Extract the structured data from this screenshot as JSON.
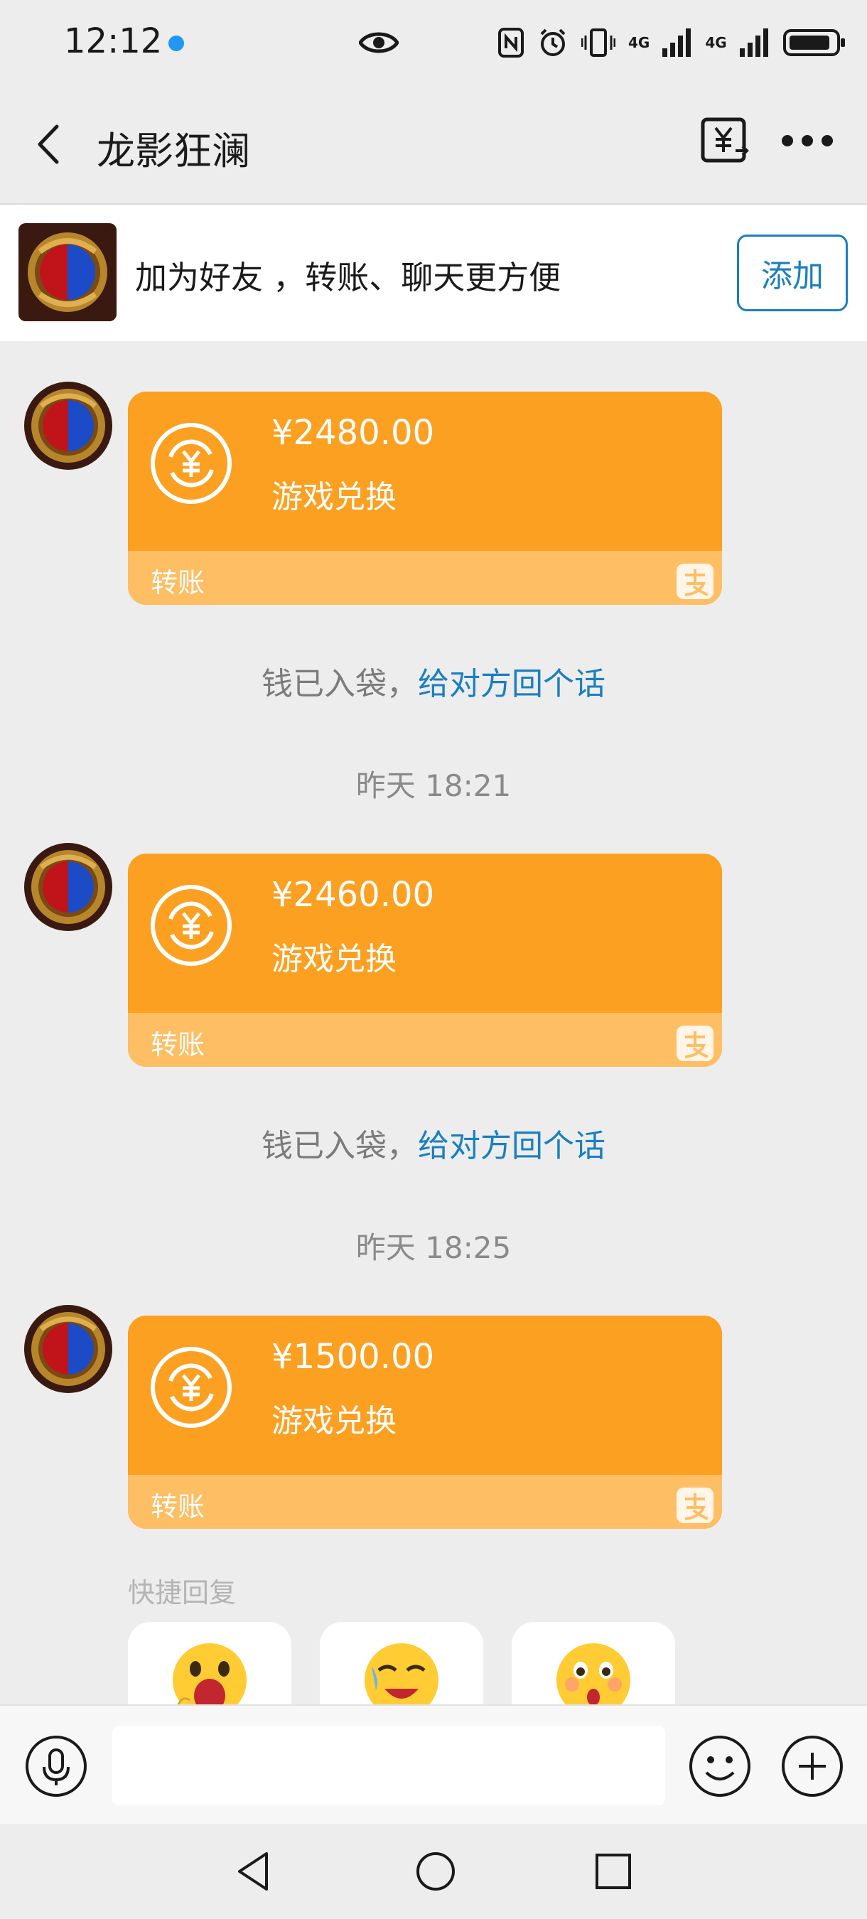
{
  "status_bar": {
    "time": "12:12",
    "network_1": "4G",
    "network_2": "4G"
  },
  "nav": {
    "title": "龙影狂澜",
    "back_icon": "back-chevron-icon",
    "transfer_icon": "yuan-transfer-icon",
    "more_icon": "more-dots-icon"
  },
  "banner": {
    "text": "加为好友 ，转账、聊天更方便",
    "add_button": "添加"
  },
  "messages": [
    {
      "amount": "¥2480.00",
      "description": "游戏兑换",
      "footer": "转账",
      "received_text": "钱已入袋，",
      "reply_link": "给对方回个话"
    },
    {
      "timestamp": "昨天 18:21",
      "amount": "¥2460.00",
      "description": "游戏兑换",
      "footer": "转账",
      "received_text": "钱已入袋，",
      "reply_link": "给对方回个话"
    },
    {
      "timestamp": "昨天 18:25",
      "amount": "¥1500.00",
      "description": "游戏兑换",
      "footer": "转账"
    }
  ],
  "quick_reply": {
    "title": "快捷回复",
    "items": [
      "shocked-emoji-icon",
      "crying-laughing-emoji-icon",
      "surprised-emoji-icon"
    ]
  },
  "input": {
    "placeholder": "",
    "value": ""
  },
  "colors": {
    "card_orange": "#fca022",
    "card_footer": "#fdbe64",
    "link_blue": "#1a7fc0",
    "background": "#ededed"
  }
}
